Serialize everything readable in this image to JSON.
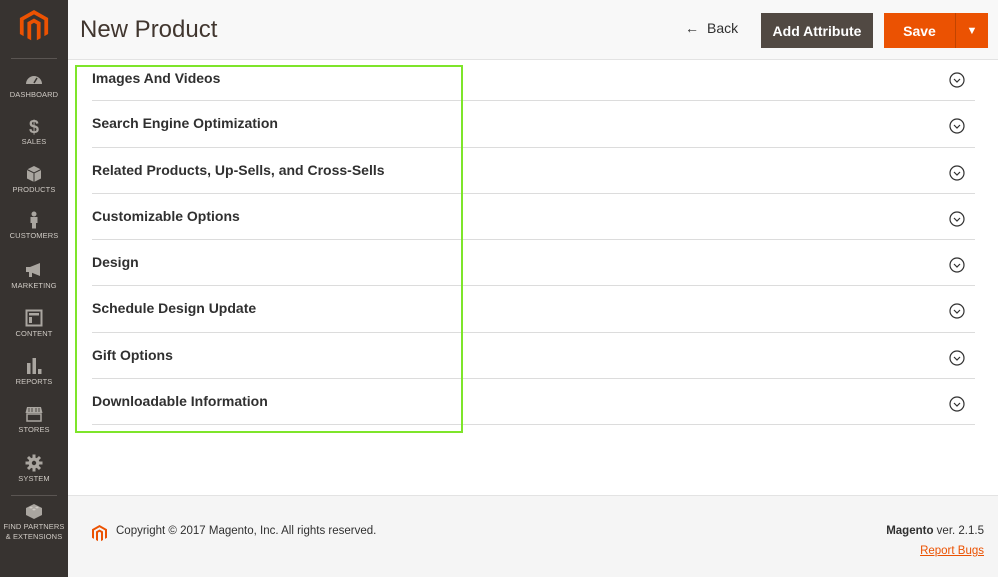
{
  "header": {
    "title": "New Product",
    "back_label": "Back",
    "add_attribute_label": "Add Attribute",
    "save_label": "Save"
  },
  "sidebar": {
    "items": [
      {
        "label": "DASHBOARD",
        "icon": "dashboard-icon"
      },
      {
        "label": "SALES",
        "icon": "dollar-icon"
      },
      {
        "label": "PRODUCTS",
        "icon": "box-icon"
      },
      {
        "label": "CUSTOMERS",
        "icon": "person-icon"
      },
      {
        "label": "MARKETING",
        "icon": "megaphone-icon"
      },
      {
        "label": "CONTENT",
        "icon": "layout-icon"
      },
      {
        "label": "REPORTS",
        "icon": "bar-chart-icon"
      },
      {
        "label": "STORES",
        "icon": "storefront-icon"
      },
      {
        "label": "SYSTEM",
        "icon": "gear-icon"
      },
      {
        "label_line1": "FIND PARTNERS",
        "label_line2": "& EXTENSIONS",
        "icon": "lego-block-icon"
      }
    ]
  },
  "sections": [
    {
      "title": "Images And Videos"
    },
    {
      "title": "Search Engine Optimization"
    },
    {
      "title": "Related Products, Up-Sells, and Cross-Sells"
    },
    {
      "title": "Customizable Options"
    },
    {
      "title": "Design"
    },
    {
      "title": "Schedule Design Update"
    },
    {
      "title": "Gift Options"
    },
    {
      "title": "Downloadable Information"
    }
  ],
  "footer": {
    "copyright": "Copyright © 2017 Magento, Inc. All rights reserved.",
    "brand": "Magento",
    "version": " ver. 2.1.5",
    "report_bugs_label": "Report Bugs"
  },
  "colors": {
    "accent": "#eb5202",
    "sidebar_bg": "#373330",
    "secondary_button": "#514943",
    "highlight_border": "#7ee52a"
  }
}
